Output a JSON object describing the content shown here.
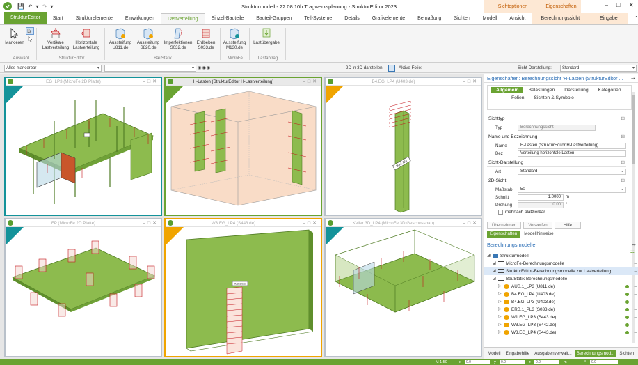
{
  "window": {
    "title": "Strukturmodell - 22 08 10b Tragwerksplanung - StrukturEditor 2023",
    "contextual_group_1": "Sichtoptionen",
    "contextual_group_2": "Eigenschaften",
    "controls": [
      "–",
      "□",
      "✕"
    ]
  },
  "ribbon_tabs": [
    {
      "label": "StrukturEditor",
      "kind": "app"
    },
    {
      "label": "Start",
      "kind": "normal"
    },
    {
      "label": "Strukturelemente",
      "kind": "normal"
    },
    {
      "label": "Einwirkungen",
      "kind": "normal"
    },
    {
      "label": "Lastverteilung",
      "kind": "active"
    },
    {
      "label": "Einzel-Bauteile",
      "kind": "normal"
    },
    {
      "label": "Bauteil-Gruppen",
      "kind": "normal"
    },
    {
      "label": "Teil-Systeme",
      "kind": "normal"
    },
    {
      "label": "Details",
      "kind": "normal"
    },
    {
      "label": "Grafikelemente",
      "kind": "normal"
    },
    {
      "label": "Bemaßung",
      "kind": "normal"
    },
    {
      "label": "Sichten",
      "kind": "normal"
    },
    {
      "label": "Modell",
      "kind": "normal"
    },
    {
      "label": "Ansicht",
      "kind": "normal"
    },
    {
      "label": "Berechnungssicht",
      "kind": "ctx"
    },
    {
      "label": "Eingabe",
      "kind": "ctx"
    }
  ],
  "ribbon": {
    "markieren": "Markieren",
    "vertikale": "Vertikale\nLastverteilung",
    "horizontale": "Horizontale\nLastverteilung",
    "u811": "Aussteifung\nU811.de",
    "s820": "Aussteifung\nS820.de",
    "s032": "Imperfektionen\nS032.de",
    "s033": "Erdbeben\nS033.de",
    "m130": "Aussteifung\nM130.de",
    "lastuebergabe": "Lastübergabe",
    "groups": {
      "auswahl": "Auswahl",
      "strukturEditor": "StrukturEditor",
      "baustatik": "BauStatik",
      "microfe": "MicroFe",
      "lastabtrag": "Lastabtrag"
    }
  },
  "filterbar": {
    "selection_filter": "Alles markierbar",
    "label_2d_in_3d": "2D in 3D darstellen:",
    "aktive_folie": "Aktive Folie:",
    "sicht_darstellung_label": "Sicht-Darstellung:",
    "sicht_darstellung_value": "Standard"
  },
  "viewports": [
    {
      "title": "EG_LP3 (MicroFe 2D Platte)",
      "active": false,
      "accent": "#14939a"
    },
    {
      "title": "H-Lasten (StrukturEditor H-Lastverteilung)",
      "active": true,
      "accent": "#6aa332"
    },
    {
      "title": "B4.EG_LP4 (U403.de)",
      "active": false,
      "accent": "#f0a400"
    },
    {
      "title": "FP (MicroFe 2D Platte)",
      "active": false,
      "accent": "#14939a"
    },
    {
      "title": "W3.EG_LP4 (S443.de)",
      "active": false,
      "accent": "#f0a400"
    },
    {
      "title": "Keller 3D_LP4 (MicroFe 3D Geschossbau)",
      "active": false,
      "accent": "#14939a"
    }
  ],
  "viewport_labels": {
    "column_label": "B4.1.EG",
    "wall_label": "W3.1.EG"
  },
  "properties": {
    "header": "Eigenschaften: Berechnungssicht 'H-Lasten (StrukturEditor ...",
    "tabs": [
      "Allgemein",
      "Belastungen",
      "Darstellung",
      "Kategorien",
      "Folien",
      "Sichten & Symbole"
    ],
    "sections": {
      "sichttyp": "Sichttyp",
      "name": "Name und Bezeichnung",
      "darstellung": "Sicht-Darstellung",
      "sicht2d": "2D-Sicht"
    },
    "fields": {
      "typ_label": "Typ",
      "typ_value": "Berechnungssicht",
      "name_label": "Name",
      "name_value": "H-Lasten (StrukturEditor H-Lastverteilung)",
      "bez_label": "Bez",
      "bez_value": "Verteilung horizontale Lasten",
      "art_label": "Art",
      "art_value": "Standard",
      "massstab_label": "Maßstab",
      "massstab_value": "50",
      "schnitt_label": "Schnitt",
      "schnitt_value": "1.0000",
      "schnitt_unit": "m",
      "drehung_label": "Drehung",
      "drehung_value": "0.00",
      "drehung_unit": "°",
      "mehrfach": "mehrfach platzierbar"
    },
    "buttons": [
      "Übernehmen",
      "Verwerfen",
      "Hilfe"
    ],
    "subtabs": [
      "Eigenschaften",
      "Modellhinweise"
    ]
  },
  "berechnungsmodelle": {
    "title": "Berechnungsmodelle",
    "tree": [
      {
        "label": "Strukturmodell",
        "level": 0,
        "kind": "folder"
      },
      {
        "label": "MicroFe-Berechnungsmodelle",
        "level": 1,
        "kind": "list"
      },
      {
        "label": "StrukturEditor-Berechnungsmodelle zur Lastverteilung",
        "level": 1,
        "kind": "list",
        "selected": true
      },
      {
        "label": "BauStatik-Berechnungsmodelle",
        "level": 1,
        "kind": "list"
      },
      {
        "label": "AUS.1_LP3 (U811.de)",
        "level": 2,
        "kind": "model"
      },
      {
        "label": "B4.EG_LP4 (U403.de)",
        "level": 2,
        "kind": "model"
      },
      {
        "label": "B4.EG_LP3 (U403.de)",
        "level": 2,
        "kind": "model"
      },
      {
        "label": "ERB.1_PL3 (S033.de)",
        "level": 2,
        "kind": "model"
      },
      {
        "label": "W1.EG_LP3 (S443.de)",
        "level": 2,
        "kind": "model"
      },
      {
        "label": "W3.EG_LP3 (S442.de)",
        "level": 2,
        "kind": "model"
      },
      {
        "label": "W3.EG_LP4 (S443.de)",
        "level": 2,
        "kind": "model"
      }
    ]
  },
  "bottom_tabs": [
    {
      "label": "Modell",
      "active": false
    },
    {
      "label": "Eingabehilfe",
      "active": false
    },
    {
      "label": "Ausgabenverwalt...",
      "active": false
    },
    {
      "label": "Berechnungsmod...",
      "active": true
    },
    {
      "label": "Sichten",
      "active": false
    }
  ],
  "statusbar": {
    "scale": "M 1:50",
    "x_label": "x",
    "x_value": "0.0",
    "y_label": "y",
    "y_value": "0.0",
    "z_label": "z",
    "z_value": "0.0",
    "m_label": "m",
    "c_label": "°",
    "c_value": "0.0"
  },
  "colors": {
    "accent_green": "#6aa332",
    "teal": "#14939a",
    "orange": "#f0a400",
    "slab_green": "#8dbb4e",
    "load_red": "#c4161c"
  }
}
